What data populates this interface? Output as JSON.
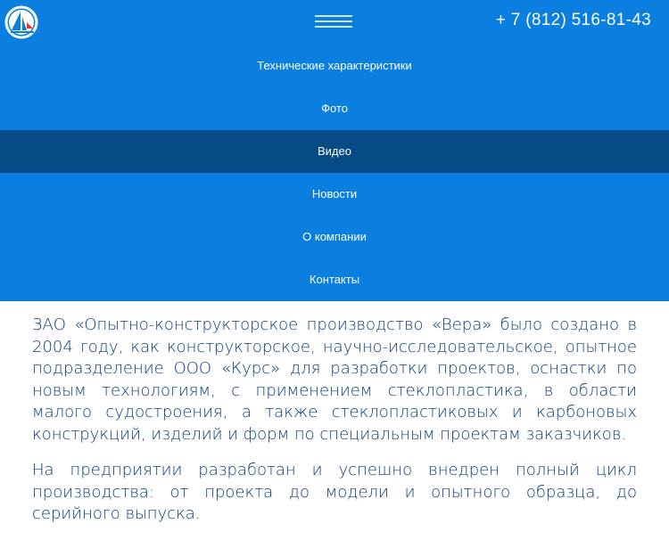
{
  "header": {
    "phone": "+ 7 (812) 516-81-43",
    "colors": {
      "background": "#0a7fe0",
      "active": "#064a86",
      "text_body": "#0a3a7a"
    },
    "logo_icon": "sailboat-logo-icon",
    "menu_icon": "hamburger-icon"
  },
  "nav": {
    "items": [
      {
        "label": "Технические характеристики",
        "active": false
      },
      {
        "label": "Фото",
        "active": false
      },
      {
        "label": "Видео",
        "active": true
      },
      {
        "label": "Новости",
        "active": false
      },
      {
        "label": "О компании",
        "active": false
      },
      {
        "label": "Контакты",
        "active": false
      }
    ]
  },
  "content": {
    "paragraphs": [
      "ЗАО «Опытно-конструкторское производство «Вера» было создано в 2004 году, как конструкторское, научно-исследовательское, опытное подразделение ООО «Курс» для разработки проектов, оснастки по новым технологиям, с применением стеклопластика, в области малого судостроения, а также стеклопластиковых и карбоновых конструкций, изделий и форм по специальным проектам заказчиков.",
      "На предприятии разработан и успешно внедрен полный цикл производства: от проекта до модели и опытного образца, до серийного выпуска."
    ]
  }
}
